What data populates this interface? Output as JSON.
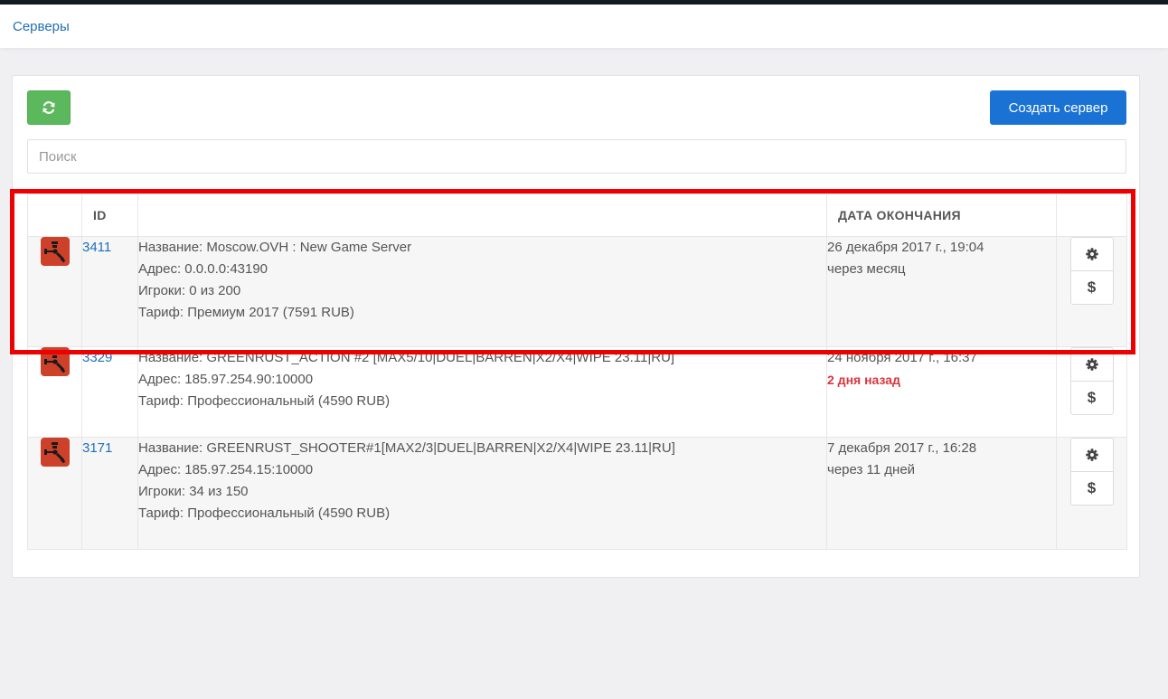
{
  "breadcrumb": "Серверы",
  "toolbar": {
    "refresh_icon": "refresh-icon",
    "create_label": "Создать сервер"
  },
  "search": {
    "placeholder": "Поиск",
    "value": ""
  },
  "table": {
    "headers": {
      "icon": "",
      "id": "ID",
      "info": "",
      "date": "ДАТА ОКОНЧАНИЯ",
      "actions": ""
    },
    "rows": [
      {
        "id": "3411",
        "name": "Название: Moscow.OVH : New Game Server",
        "address": "Адрес: 0.0.0.0:43190",
        "players": "Игроки: 0 из 200",
        "tariff": "Тариф: Премиум 2017 (7591 RUB)",
        "end_date": "26 декабря 2017 г., 19:04",
        "status": "через месяц",
        "status_type": "normal"
      },
      {
        "id": "3329",
        "name": "Название: GREENRUST_ACTION #2 [MAX5/10|DUEL|BARREN|X2/X4|WIPE 23.11|RU]",
        "address": "Адрес: 185.97.254.90:10000",
        "players": "",
        "tariff": "Тариф: Профессиональный (4590 RUB)",
        "end_date": "24 ноября 2017 г., 16:37",
        "status": "2 дня назад",
        "status_type": "danger"
      },
      {
        "id": "3171",
        "name": "Название: GREENRUST_SHOOTER#1[MAX2/3|DUEL|BARREN|X2/X4|WIPE 23.11|RU]",
        "address": "Адрес: 185.97.254.15:10000",
        "players": "Игроки: 34 из 150",
        "tariff": "Тариф: Профессиональный (4590 RUB)",
        "end_date": "7 декабря 2017 г., 16:28",
        "status": "через 11 дней",
        "status_type": "normal"
      }
    ],
    "action_icons": [
      "gear-icon",
      "dollar-icon"
    ],
    "dollar_symbol": "$"
  },
  "colors": {
    "accent": "#1a73d4",
    "success": "#5cb85c",
    "danger": "#d9363e",
    "game_icon": "#cd412b",
    "highlight": "#ee0000"
  }
}
